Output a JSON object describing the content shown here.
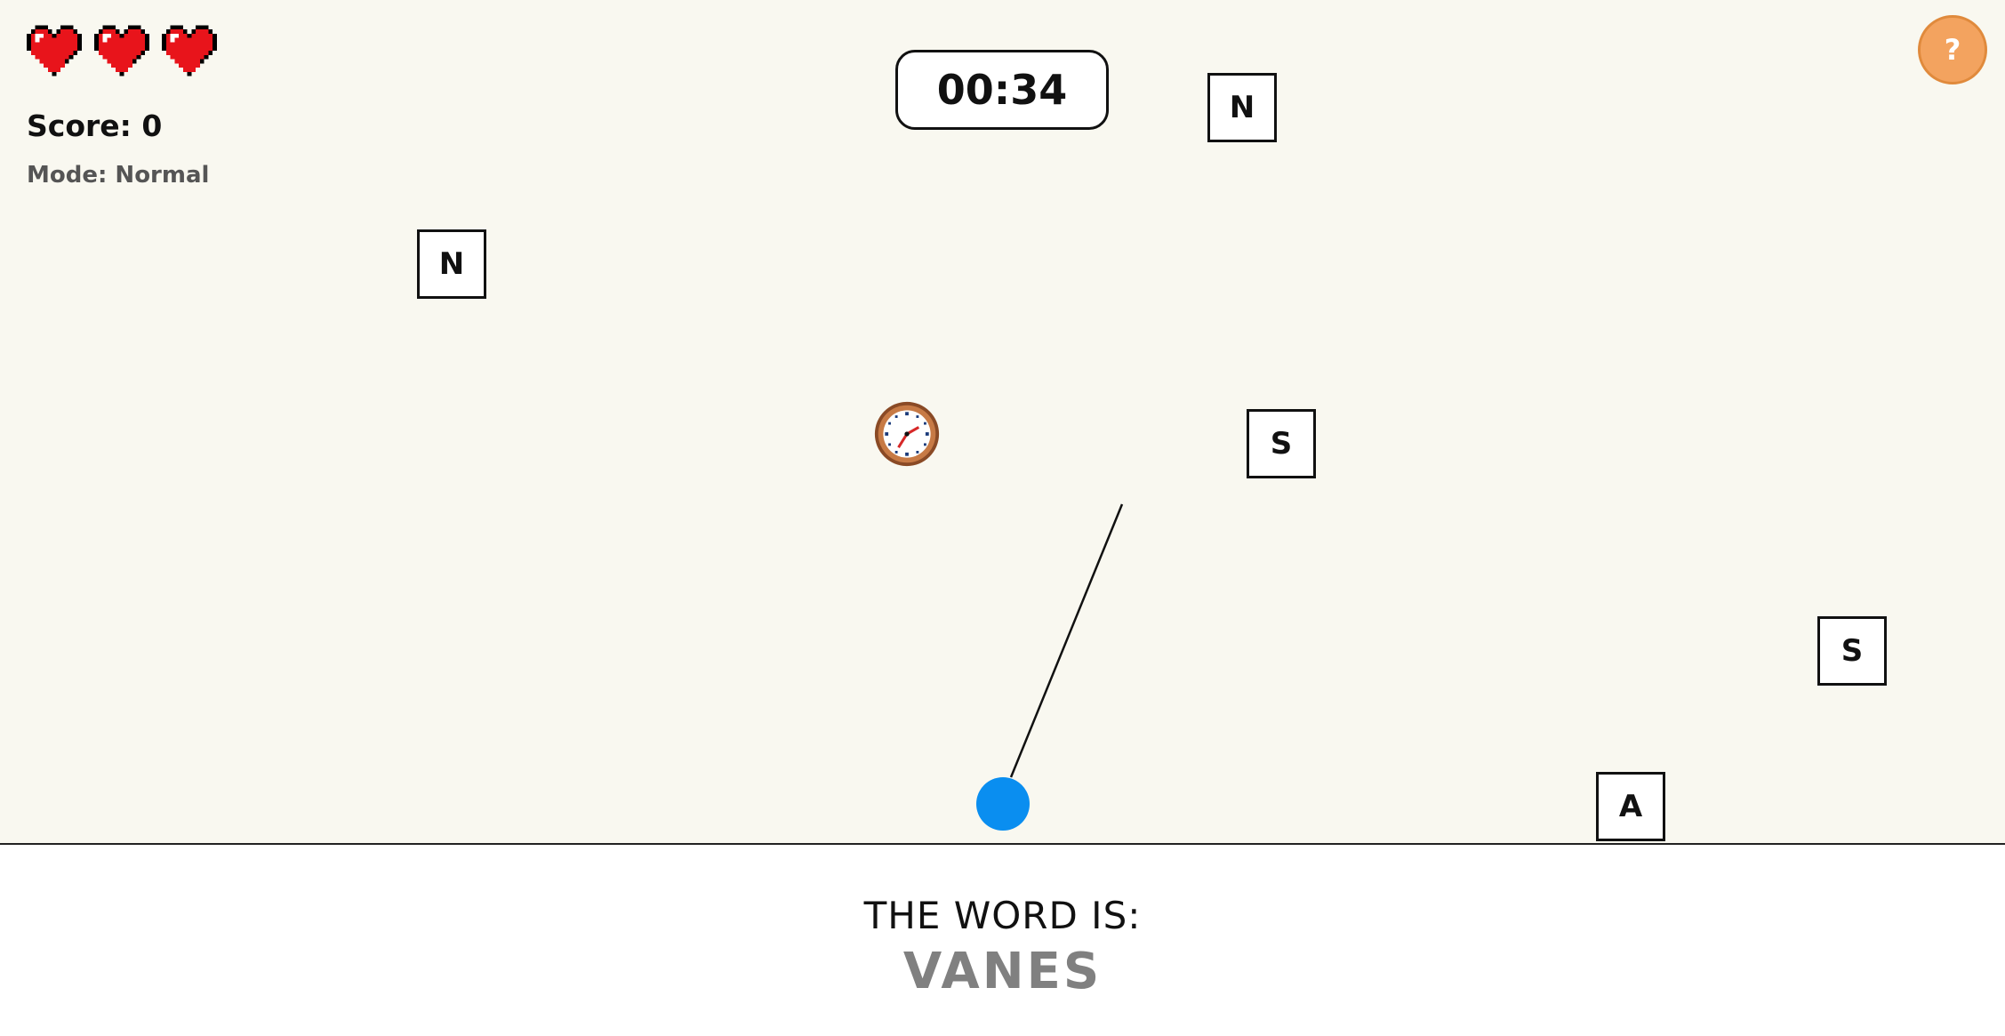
{
  "hud": {
    "lives": 3,
    "score_text": "Score: 0",
    "mode_text": "Mode: Normal",
    "timer": "00:34",
    "help_label": "?"
  },
  "tiles": [
    {
      "letter": "N"
    },
    {
      "letter": "N"
    },
    {
      "letter": "S"
    },
    {
      "letter": "S"
    },
    {
      "letter": "A"
    }
  ],
  "word": {
    "label": "THE WORD IS:",
    "value": "VANES"
  },
  "colors": {
    "background": "#f9f8f0",
    "player": "#0a8ef0",
    "help_button": "#f3a35f",
    "heart": "#e8141b",
    "word_value": "#808080"
  },
  "icons": [
    "heart-icon",
    "clock-icon",
    "help-icon"
  ]
}
